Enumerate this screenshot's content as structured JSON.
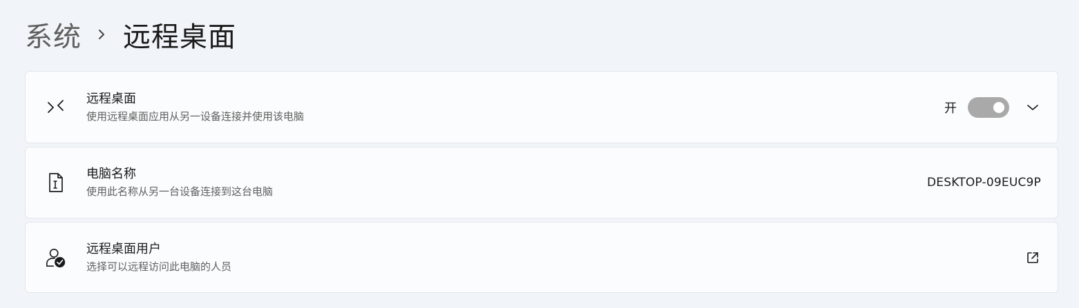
{
  "breadcrumb": {
    "parent": "系统",
    "current": "远程桌面"
  },
  "cards": {
    "remote_desktop": {
      "icon": "remote-desktop-icon",
      "title": "远程桌面",
      "subtitle": "使用远程桌面应用从另一设备连接并使用该电脑",
      "toggle_state_label": "开",
      "toggle_on": true
    },
    "pc_name": {
      "icon": "pc-name-icon",
      "title": "电脑名称",
      "subtitle": "使用此名称从另一台设备连接到这台电脑",
      "value": "DESKTOP-09EUC9P"
    },
    "remote_users": {
      "icon": "user-check-icon",
      "title": "远程桌面用户",
      "subtitle": "选择可以远程访问此电脑的人员"
    }
  },
  "colors": {
    "background": "#f1f4f8",
    "card": "#fbfcfd",
    "toggle_track": "#a9a9a9"
  }
}
